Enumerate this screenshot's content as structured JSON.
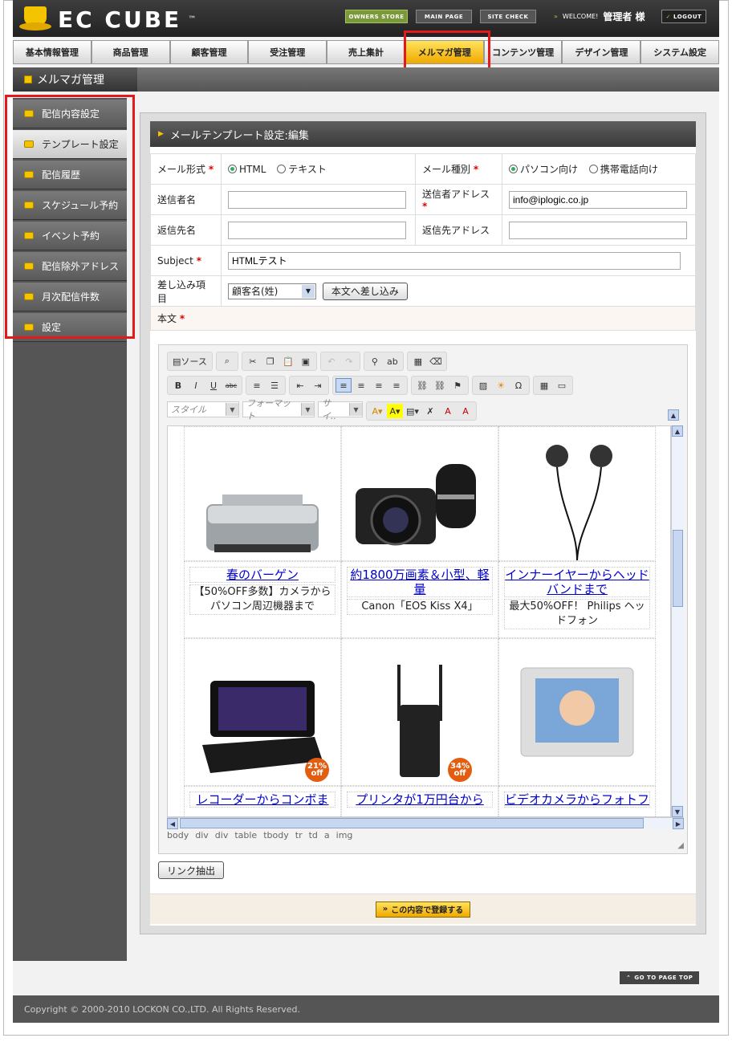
{
  "header": {
    "logo": "EC CUBE",
    "tm": "™",
    "owners_store": "OWNERS STORE",
    "main_page": "MAIN PAGE",
    "site_check": "SITE CHECK",
    "welcome": "WELCOME!",
    "user": "管理者 様",
    "logout": "LOGOUT"
  },
  "nav": [
    "基本情報管理",
    "商品管理",
    "顧客管理",
    "受注管理",
    "売上集計",
    "メルマガ管理",
    "コンテンツ管理",
    "デザイン管理",
    "システム設定"
  ],
  "section_title": "メルマガ管理",
  "sidebar": [
    "配信内容設定",
    "テンプレート設定",
    "配信履歴",
    "スケジュール予約",
    "イベント予約",
    "配信除外アドレス",
    "月次配信件数",
    "設定"
  ],
  "panel_title": "メールテンプレート設定:編集",
  "form": {
    "mail_format_label": "メール形式",
    "html": "HTML",
    "text": "テキスト",
    "mail_type_label": "メール種別",
    "pc": "パソコン向け",
    "mobile": "携帯電話向け",
    "sender_name_label": "送信者名",
    "sender_addr_label": "送信者アドレス",
    "sender_addr_value": "info@iplogic.co.jp",
    "reply_name_label": "返信先名",
    "reply_addr_label": "返信先アドレス",
    "subject_label": "Subject",
    "subject_value": "HTMLテスト",
    "insert_label": "差し込み項目",
    "insert_select": "顧客名(姓)",
    "insert_button": "本文へ差し込み",
    "body_label": "本文",
    "req": "*"
  },
  "editor": {
    "source": "ソース",
    "style": "スタイル",
    "format": "フォーマット",
    "size": "サイ..",
    "status_path": [
      "body",
      "div",
      "div",
      "table",
      "tbody",
      "tr",
      "td",
      "a",
      "img"
    ],
    "products": [
      {
        "title": "春のバーゲン",
        "desc": "【50%OFF多数】カメラからパソコン周辺機器まで"
      },
      {
        "title": "約1800万画素＆小型、軽量",
        "desc": "Canon「EOS Kiss X4」"
      },
      {
        "title": "インナーイヤーからヘッドバンドまで",
        "desc": "最大50%OFF！ Philips ヘッドフォン"
      }
    ],
    "products2": [
      "レコーダーからコンボま",
      "プリンタが1万円台から",
      "ビデオカメラからフォトフ"
    ],
    "badge1": "21% off",
    "badge2": "34% off"
  },
  "link_extract": "リンク抽出",
  "submit": "この内容で登録する",
  "page_top": "GO TO PAGE TOP",
  "copyright": "Copyright © 2000-2010 LOCKON CO.,LTD. All Rights Reserved."
}
